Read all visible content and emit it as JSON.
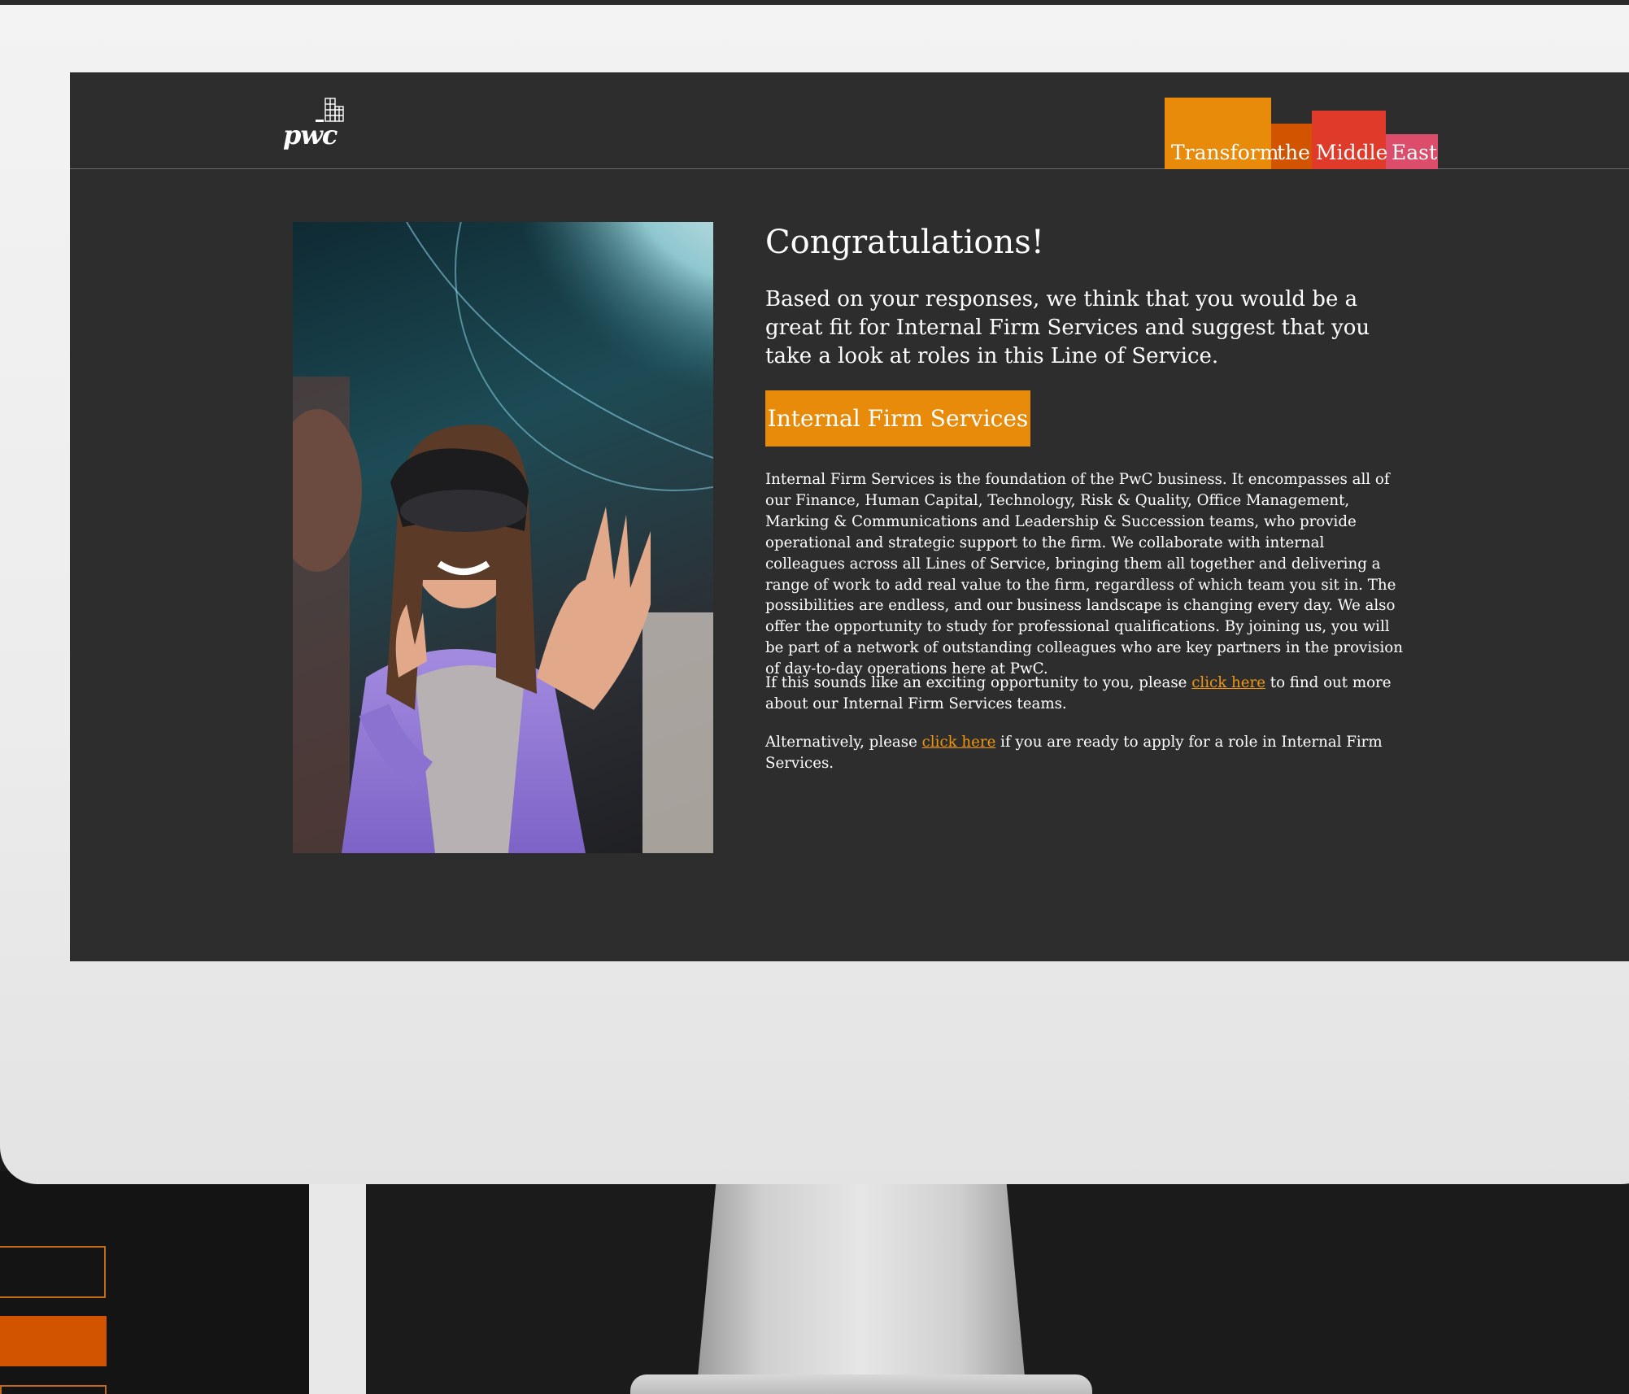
{
  "header": {
    "logo_text": "pwc",
    "brand_words": [
      "Transform",
      "the",
      "Middle",
      "East"
    ],
    "brand_colors": [
      "#e88a0a",
      "#d35400",
      "#e03a2a",
      "#db4d6a"
    ]
  },
  "main": {
    "title": "Congratulations!",
    "lead": "Based on your responses, we think that you would be a great fit for Internal Firm Services and suggest that you take a look at roles in this Line of Service.",
    "cta_label": "Internal Firm Services",
    "description": "Internal Firm Services is the foundation of the PwC business. It encompasses all of our Finance, Human Capital, Technology, Risk & Quality, Office Management, Marking & Communications and Leadership & Succession teams, who provide operational and strategic support to the firm. We collaborate with internal colleagues across all Lines of Service, bringing them all together and delivering a range of work to add real value to the firm, regardless of which team you sit in. The possibilities are endless, and our business landscape is changing every day. We also offer the opportunity to study for professional qualifications. By joining us, you will be part of a network of outstanding colleagues who are key partners in the provision of day-to-day operations here at PwC.",
    "para2_before": "If this sounds like an exciting opportunity to you, please ",
    "para2_link": "click here",
    "para2_after": " to find out more about our Internal Firm Services teams.",
    "para3_before": "Alternatively, please ",
    "para3_link": "click here",
    "para3_after": " if you are ready to apply for a role in Internal Firm Services."
  },
  "colors": {
    "accent_orange": "#e88a0a",
    "link": "#f0960f",
    "screen_bg": "#2d2d2d"
  }
}
